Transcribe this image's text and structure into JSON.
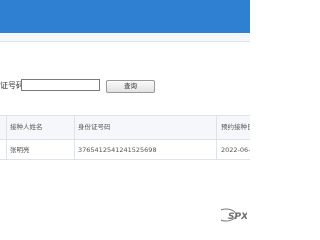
{
  "search": {
    "label": "证号码：",
    "input_value": "",
    "button_label": "查询"
  },
  "table": {
    "columns": [
      "接种人姓名",
      "身份证号码",
      "预约接种日"
    ],
    "rows": [
      [
        "张明亮",
        "376541254124152569​8",
        "2022-06-"
      ]
    ]
  },
  "footer": {
    "logo_text": "SPX"
  }
}
